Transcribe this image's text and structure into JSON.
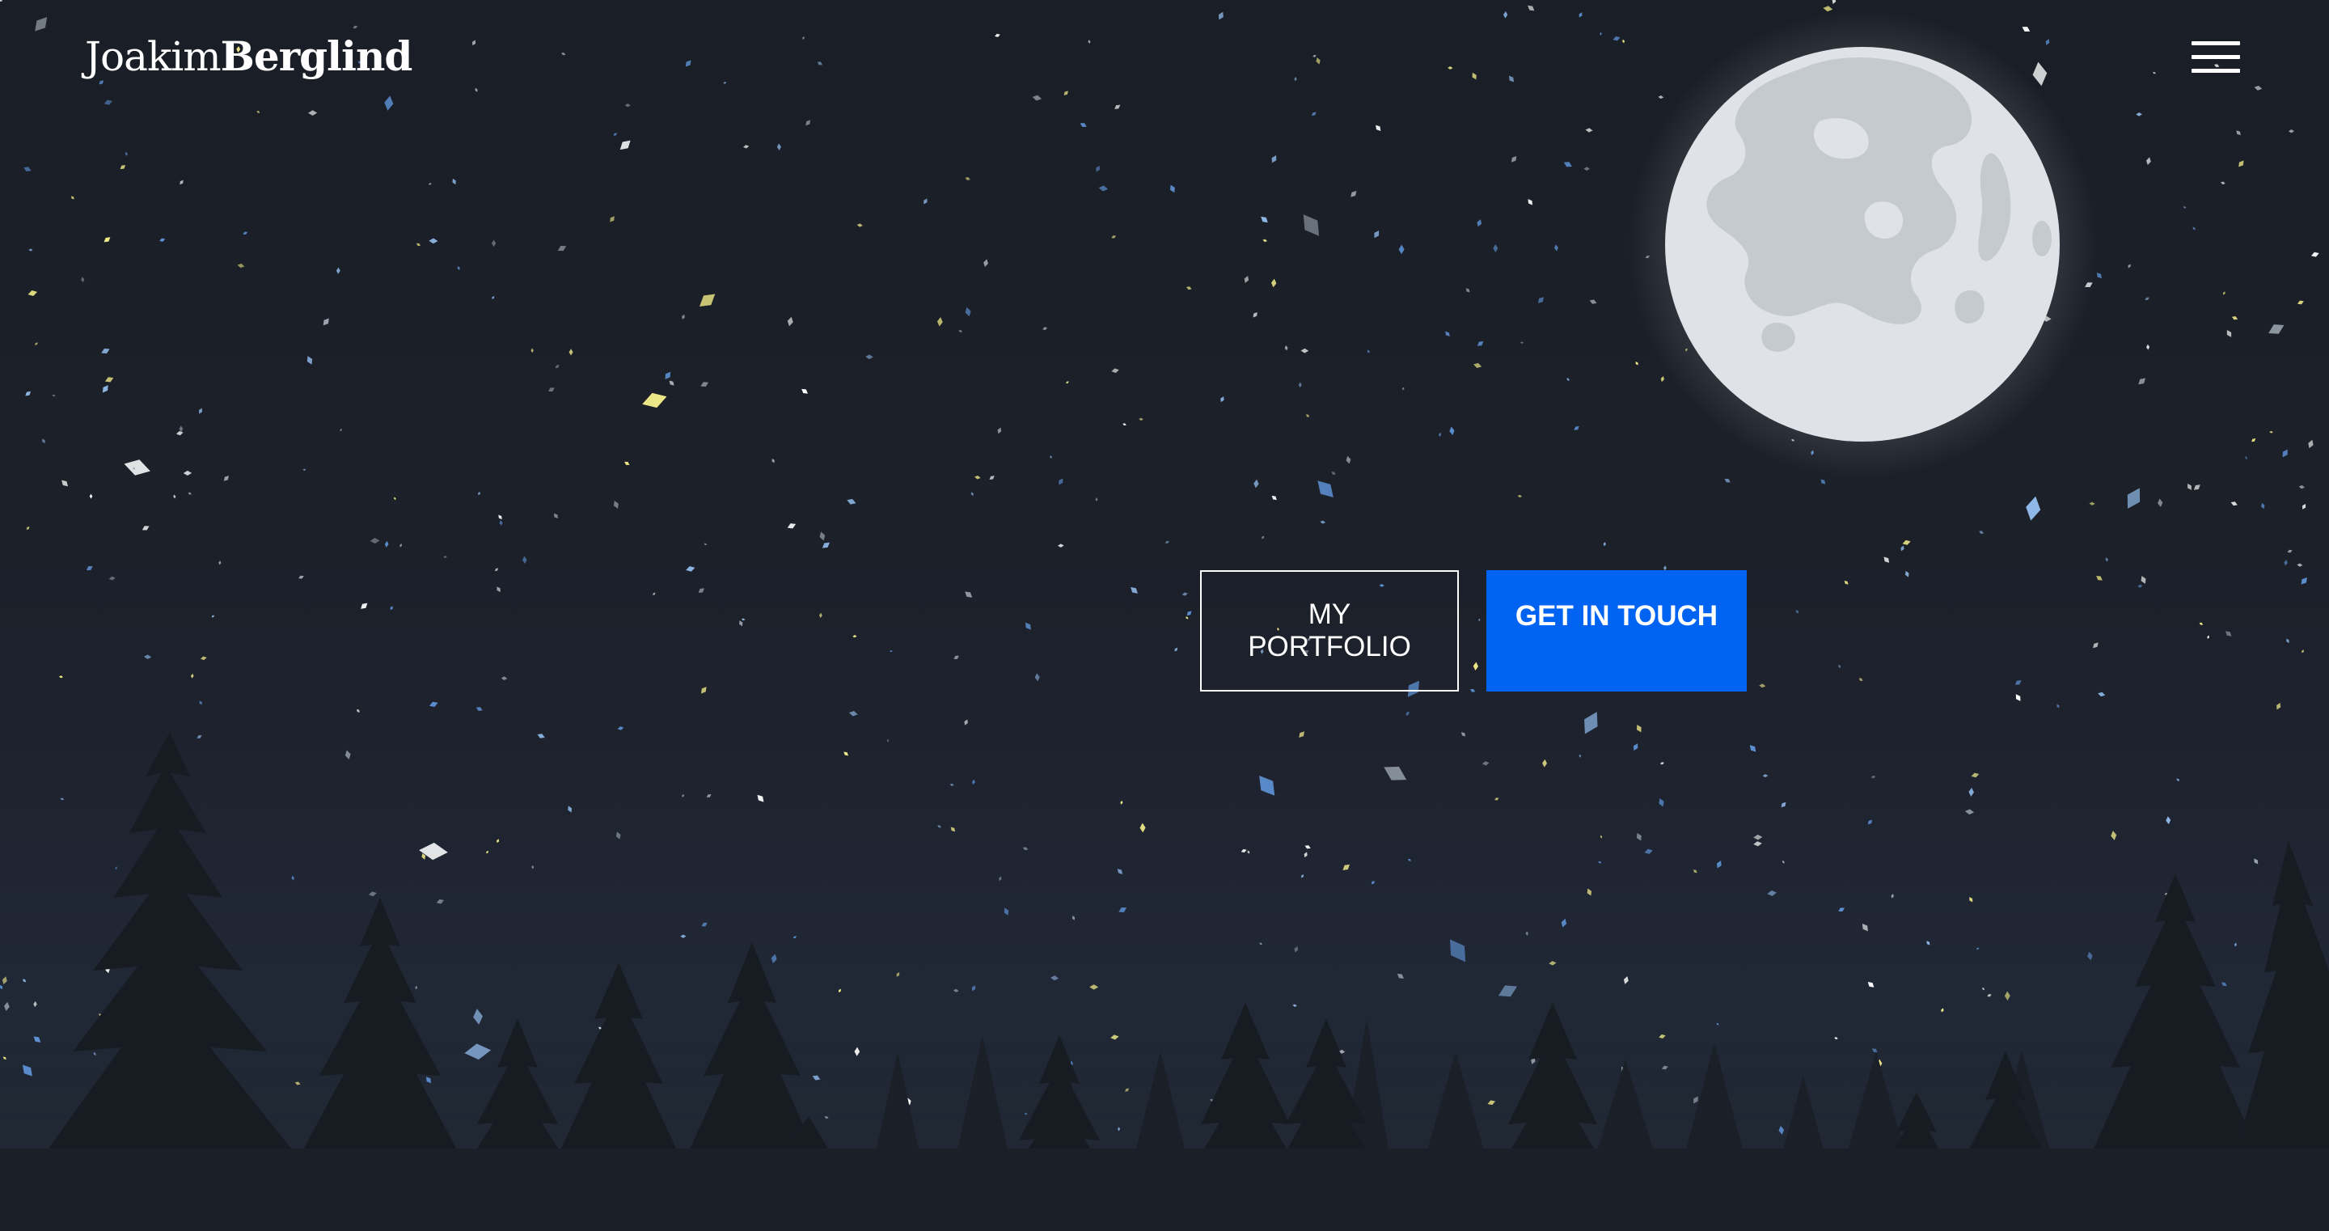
{
  "header": {
    "logo_first": "Joakim",
    "logo_last": "Berglind",
    "menu_icon": "hamburger-menu-icon"
  },
  "hero": {
    "portfolio_label": "MY PORTFOLIO",
    "contact_label": "GET IN TOUCH"
  },
  "colors": {
    "sky": "#1b1f27",
    "moon": "#dfe2e6",
    "moon_craters": "#c5cad1",
    "trees": "#171b22",
    "accent": "#0063f2",
    "stars": [
      "#ffffff",
      "#8fb8e8",
      "#5e93d6",
      "#f4ee8a",
      "#9aa3ad"
    ]
  }
}
